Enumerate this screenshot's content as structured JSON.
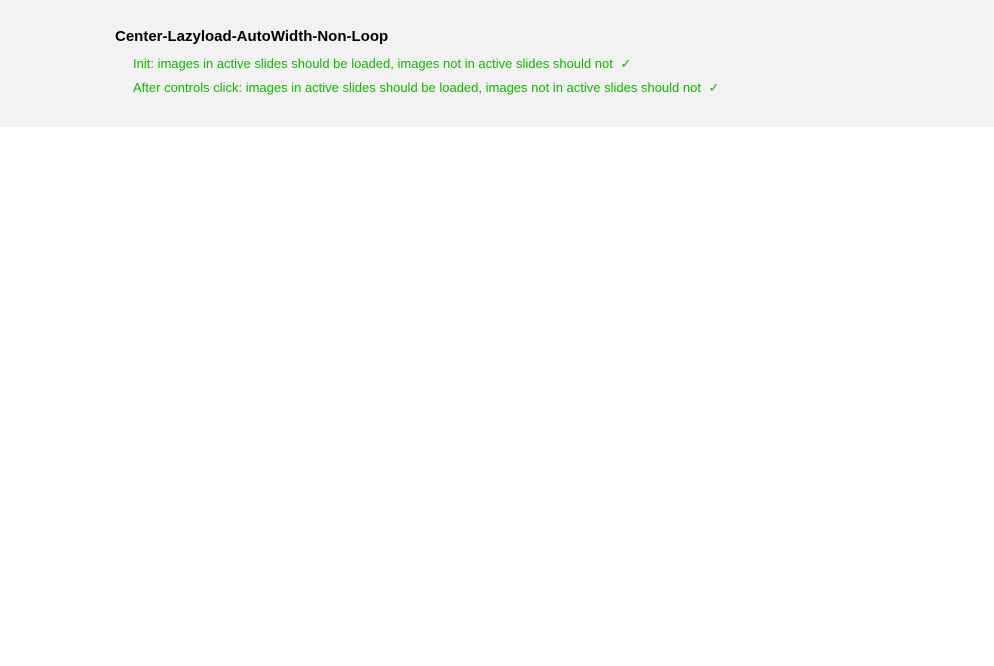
{
  "panel": {
    "title": "Center-Lazyload-AutoWidth-Non-Loop",
    "results": [
      {
        "text": "Init: images in active slides should be loaded, images not in active slides should not",
        "check": "✓"
      },
      {
        "text": "After controls click: images in active slides should be loaded, images not in active slides should not",
        "check": "✓"
      }
    ]
  }
}
